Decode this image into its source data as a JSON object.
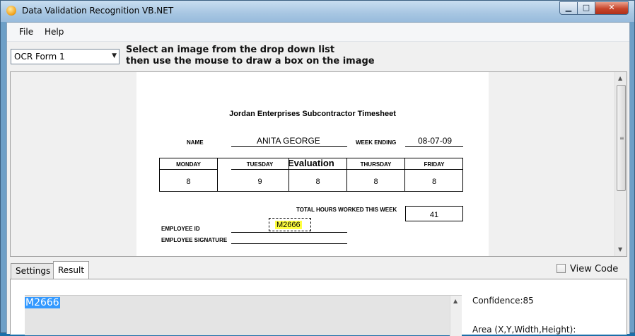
{
  "window": {
    "title": "Data Validation Recognition VB.NET",
    "min_glyph": "▁",
    "max_glyph": "□",
    "close_glyph": "✕"
  },
  "menu": {
    "items": [
      "File",
      "Help"
    ]
  },
  "toolbar": {
    "form_select_value": "OCR Form 1",
    "instruction_line1": "Select an image from the drop down list",
    "instruction_line2": "then use the mouse to draw a box on the image"
  },
  "form": {
    "title": "Jordan Enterprises Subcontractor Timesheet",
    "name_label": "NAME",
    "name_value": "ANITA GEORGE",
    "week_ending_label": "WEEK ENDING",
    "week_ending_value": "08-07-09",
    "days": [
      {
        "label": "MONDAY",
        "hours": "8"
      },
      {
        "label": "TUESDAY",
        "hours": "9"
      },
      {
        "label": "",
        "hours": "8"
      },
      {
        "label": "THURSDAY",
        "hours": "8"
      },
      {
        "label": "FRIDAY",
        "hours": "8"
      }
    ],
    "watermark": "Evaluation",
    "total_label": "TOTAL HOURS WORKED THIS WEEK",
    "total_value": "41",
    "employee_id_label": "EMPLOYEE ID",
    "employee_id_value": "M2666",
    "signature_label": "EMPLOYEE SIGNATURE"
  },
  "tabs": [
    {
      "label": "Settings",
      "active": false
    },
    {
      "label": "Result",
      "active": true
    }
  ],
  "view_code_label": "View Code",
  "result": {
    "text": "M2666",
    "confidence": "Confidence:85",
    "area_label": "Area (X,Y,Width,Height):"
  },
  "colors": {
    "selection": "#3399ff",
    "highlight": "#ffff40",
    "title_gradient": "#a7c6e2"
  }
}
